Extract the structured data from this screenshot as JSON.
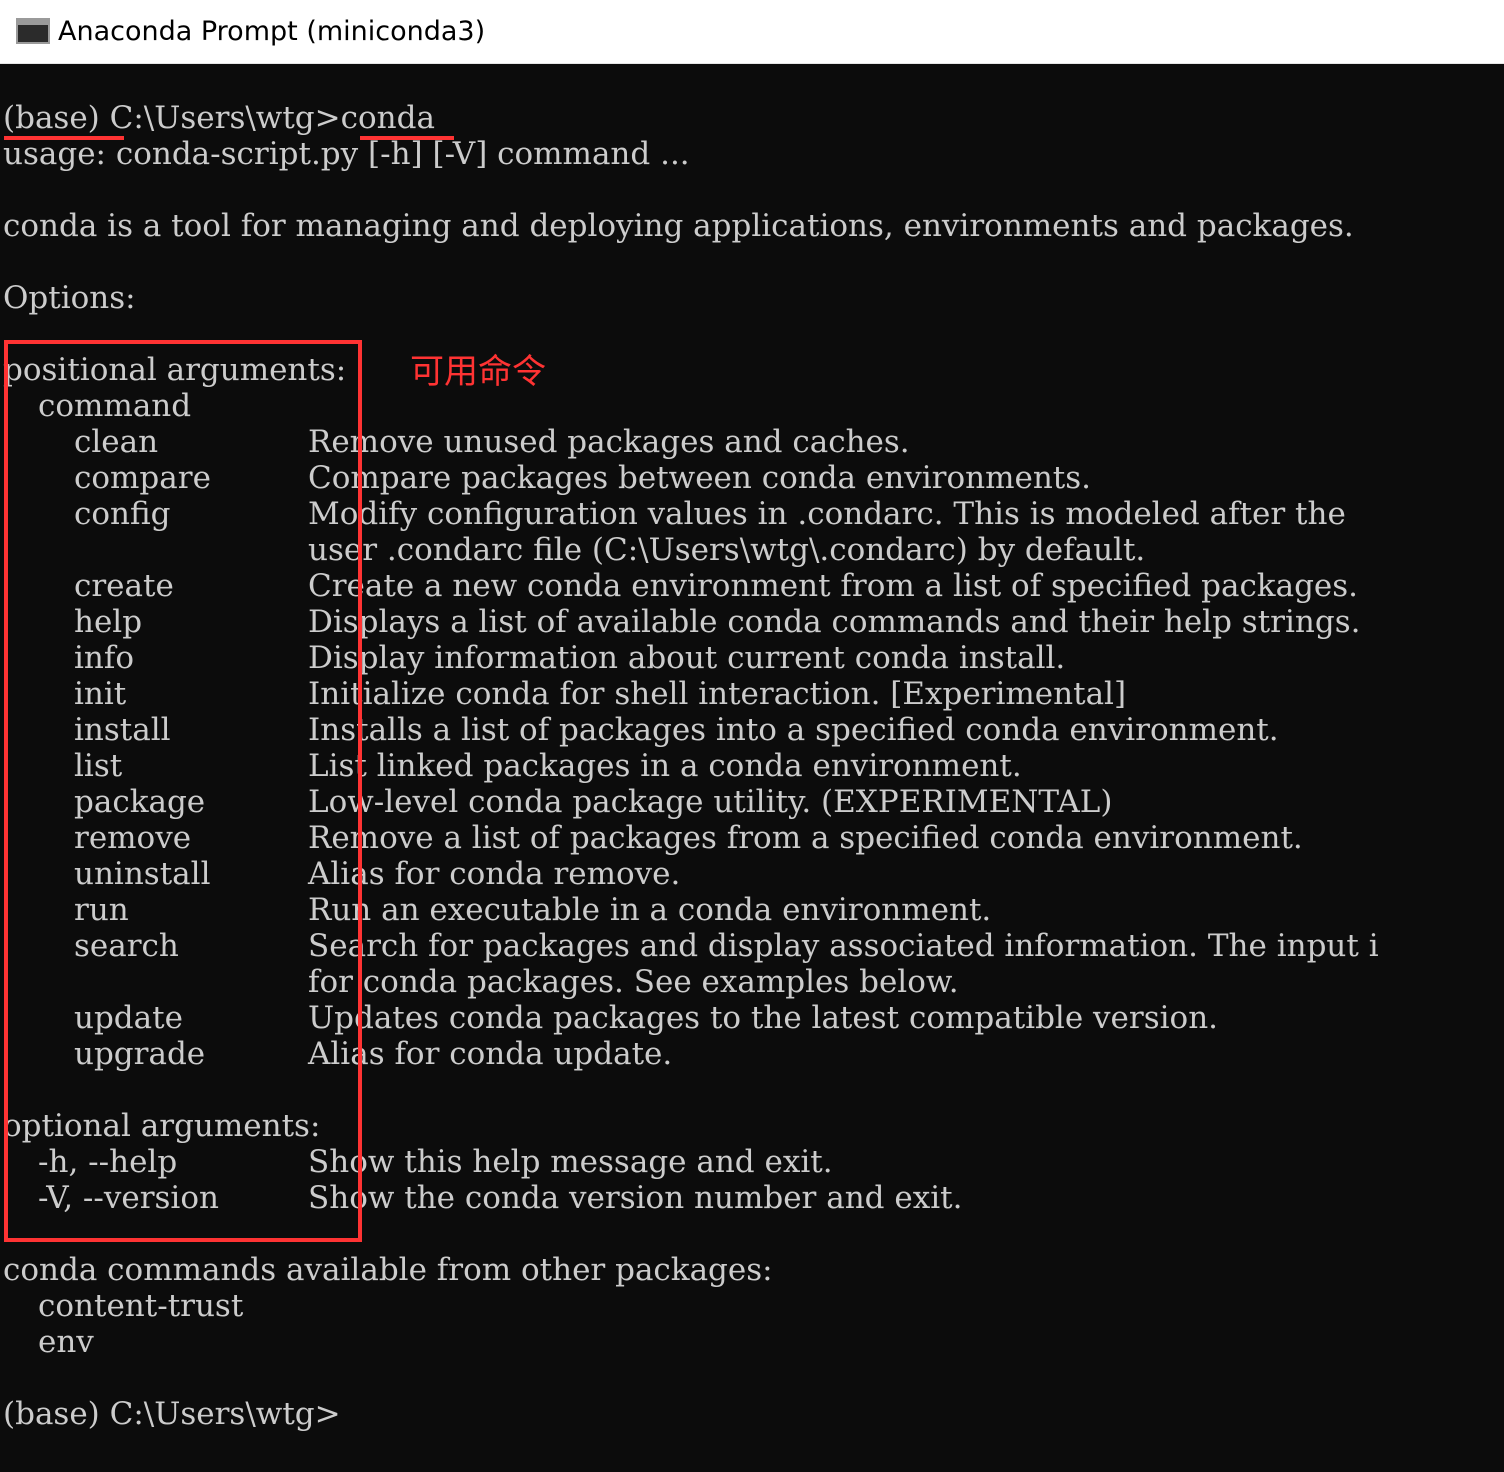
{
  "window": {
    "title": "Anaconda Prompt (miniconda3)",
    "icon": "console-window-icon"
  },
  "console": {
    "prompt_line": {
      "env": "(base)",
      "path": "C:\\Users\\wtg>",
      "command": "conda"
    },
    "usage": "usage: conda-script.py [-h] [-V] command ...",
    "description": "conda is a tool for managing and deploying applications, environments and packages.",
    "options_header": "Options:",
    "positional_header": "positional arguments:",
    "command_label": "command",
    "commands": [
      {
        "name": "clean",
        "desc": "Remove unused packages and caches."
      },
      {
        "name": "compare",
        "desc": "Compare packages between conda environments."
      },
      {
        "name": "config",
        "desc": "Modify configuration values in .condarc. This is modeled after the",
        "desc2": "user .condarc file (C:\\Users\\wtg\\.condarc) by default."
      },
      {
        "name": "create",
        "desc": "Create a new conda environment from a list of specified packages."
      },
      {
        "name": "help",
        "desc": "Displays a list of available conda commands and their help strings."
      },
      {
        "name": "info",
        "desc": "Display information about current conda install."
      },
      {
        "name": "init",
        "desc": "Initialize conda for shell interaction. [Experimental]"
      },
      {
        "name": "install",
        "desc": "Installs a list of packages into a specified conda environment."
      },
      {
        "name": "list",
        "desc": "List linked packages in a conda environment."
      },
      {
        "name": "package",
        "desc": "Low-level conda package utility. (EXPERIMENTAL)"
      },
      {
        "name": "remove",
        "desc": "Remove a list of packages from a specified conda environment."
      },
      {
        "name": "uninstall",
        "desc": "Alias for conda remove."
      },
      {
        "name": "run",
        "desc": "Run an executable in a conda environment."
      },
      {
        "name": "search",
        "desc": "Search for packages and display associated information. The input i",
        "desc2": "for conda packages. See examples below."
      },
      {
        "name": "update",
        "desc": "Updates conda packages to the latest compatible version."
      },
      {
        "name": "upgrade",
        "desc": "Alias for conda update."
      }
    ],
    "optional_header": "optional arguments:",
    "optional": [
      {
        "flag": "-h, --help",
        "desc": "Show this help message and exit."
      },
      {
        "flag": "-V, --version",
        "desc": "Show the conda version number and exit."
      }
    ],
    "other_header": "conda commands available from other packages:",
    "other_commands": [
      "content-trust",
      "env"
    ],
    "final_prompt": "(base) C:\\Users\\wtg>"
  },
  "annotation": {
    "text": "可用命令",
    "color": "#ff3333"
  },
  "colors": {
    "console_bg": "#0c0c0c",
    "console_text": "#cccccc",
    "accent": "#ff3333"
  }
}
